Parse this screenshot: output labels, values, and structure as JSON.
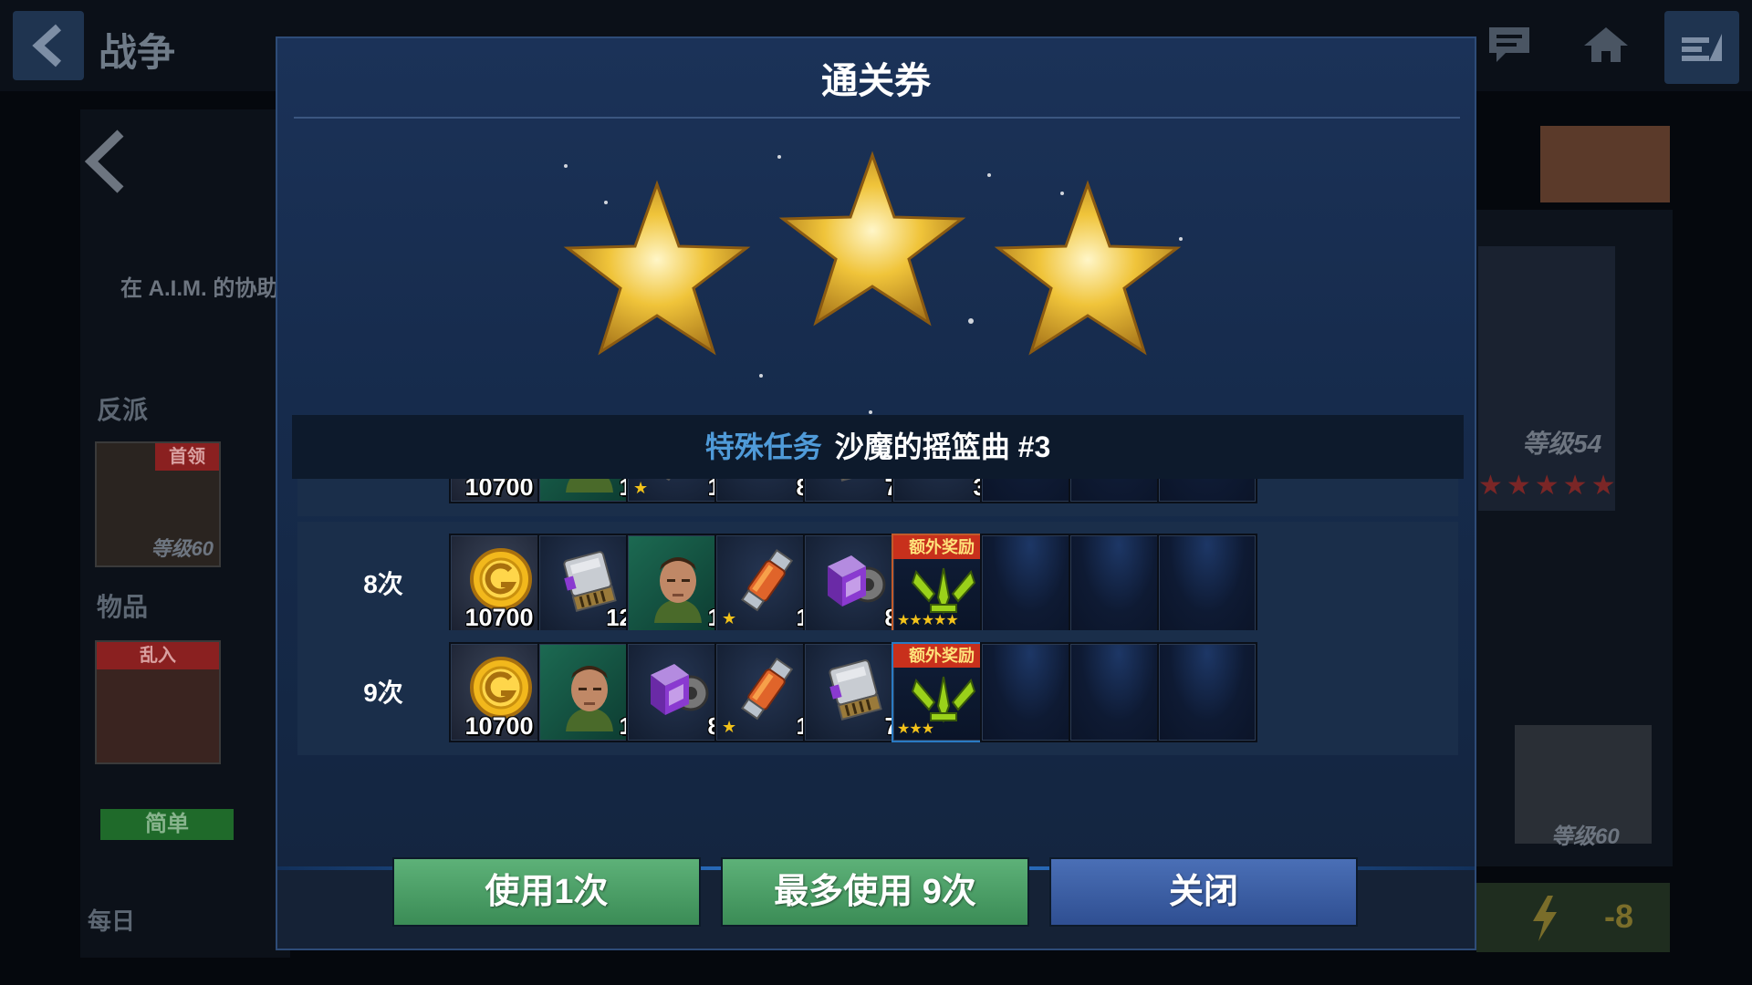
{
  "background": {
    "title": "战争",
    "mission_desc": "在 A.I.M. 的协助",
    "villains_label": "反派",
    "boss_tag": "首领",
    "villain_level": "等级60",
    "items_label": "物品",
    "intrude_tag": "乱入",
    "difficulty": "简单",
    "daily_label": "每日",
    "right_level": "等级54",
    "right_card_level": "等级60",
    "energy_cost": "-8"
  },
  "dialog": {
    "title": "通关券",
    "stars_earned": 3,
    "mission_type": "特殊任务",
    "mission_name": "沙魔的摇篮曲 #3",
    "rows": [
      {
        "label": "",
        "rewards": [
          {
            "kind": "gold",
            "icon": "gold-coin-icon",
            "amount": "10700"
          },
          {
            "kind": "hero",
            "icon": "sandman-portrait-icon",
            "qty": "1"
          },
          {
            "kind": "item",
            "icon": "ability-material-icon",
            "qty": "1",
            "stars": "★"
          },
          {
            "kind": "item",
            "icon": "uniform-cube-icon",
            "qty": "8"
          },
          {
            "kind": "item",
            "icon": "card-chip-icon",
            "qty": "7"
          },
          {
            "kind": "item",
            "icon": "uniform-cube-icon",
            "qty": "3"
          },
          {
            "kind": "empty"
          },
          {
            "kind": "empty"
          },
          {
            "kind": "empty"
          }
        ]
      },
      {
        "label": "8次",
        "rewards": [
          {
            "kind": "gold",
            "icon": "gold-coin-icon",
            "amount": "10700"
          },
          {
            "kind": "item",
            "icon": "card-chip-icon",
            "qty": "12"
          },
          {
            "kind": "hero",
            "icon": "sandman-portrait-icon",
            "qty": "1"
          },
          {
            "kind": "item",
            "icon": "ability-material-icon",
            "qty": "1",
            "stars": "★"
          },
          {
            "kind": "item",
            "icon": "uniform-cube-icon",
            "qty": "8"
          },
          {
            "kind": "bonus",
            "icon": "gear-trophy-icon",
            "tag": "额外奖励",
            "stars": "★★★★★"
          },
          {
            "kind": "empty"
          },
          {
            "kind": "empty"
          },
          {
            "kind": "empty"
          }
        ]
      },
      {
        "label": "9次",
        "rewards": [
          {
            "kind": "gold",
            "icon": "gold-coin-icon",
            "amount": "10700"
          },
          {
            "kind": "hero",
            "icon": "sandman-portrait-icon",
            "qty": "1"
          },
          {
            "kind": "item",
            "icon": "uniform-cube-icon",
            "qty": "8"
          },
          {
            "kind": "item",
            "icon": "ability-material-icon",
            "qty": "1",
            "stars": "★"
          },
          {
            "kind": "item",
            "icon": "card-chip-icon",
            "qty": "7"
          },
          {
            "kind": "bonus2",
            "icon": "gear-trophy-icon",
            "tag": "额外奖励",
            "stars": "★★★"
          },
          {
            "kind": "empty"
          },
          {
            "kind": "empty"
          },
          {
            "kind": "empty"
          }
        ]
      }
    ],
    "buttons": {
      "use_once": "使用1次",
      "use_max": "最多使用 9次",
      "close": "关闭"
    },
    "colors": {
      "green_button": "#4ea56a",
      "blue_button": "#3b5ea6",
      "mission_type": "#4f9ad8",
      "bonus_tag": "#c8301c"
    }
  }
}
